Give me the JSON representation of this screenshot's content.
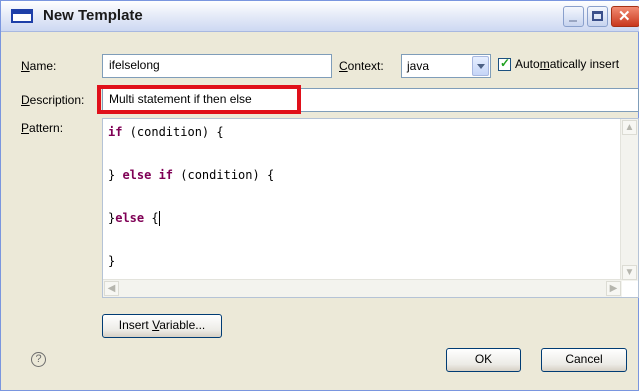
{
  "window": {
    "title": "New Template"
  },
  "form": {
    "name_label": "Name:",
    "name_value": "ifelselong",
    "context_label": "Context:",
    "context_value": "java",
    "auto_insert_label": "Automatically insert",
    "auto_insert_checked": true,
    "description_label": "Description:",
    "description_value": "Multi statement if then else",
    "pattern_label": "Pattern:"
  },
  "pattern": {
    "line1_kw": "if",
    "line1_rest": " (condition) {",
    "line2_pre": "} ",
    "line2_kw": "else if",
    "line2_rest": " (condition) {",
    "line3_pre": "}",
    "line3_kw": "else",
    "line3_rest": " {",
    "line4": "}"
  },
  "buttons": {
    "insert_variable": "Insert Variable...",
    "ok": "OK",
    "cancel": "Cancel"
  },
  "icons": [
    "window-icon",
    "minimize-icon",
    "maximize-icon",
    "close-icon",
    "dropdown-arrow-icon",
    "checkmark-icon",
    "help-icon",
    "scroll-up-icon",
    "scroll-down-icon",
    "scroll-left-icon",
    "scroll-right-icon"
  ],
  "colors": {
    "highlight": "#e0101a",
    "keyword": "#7f0055"
  }
}
